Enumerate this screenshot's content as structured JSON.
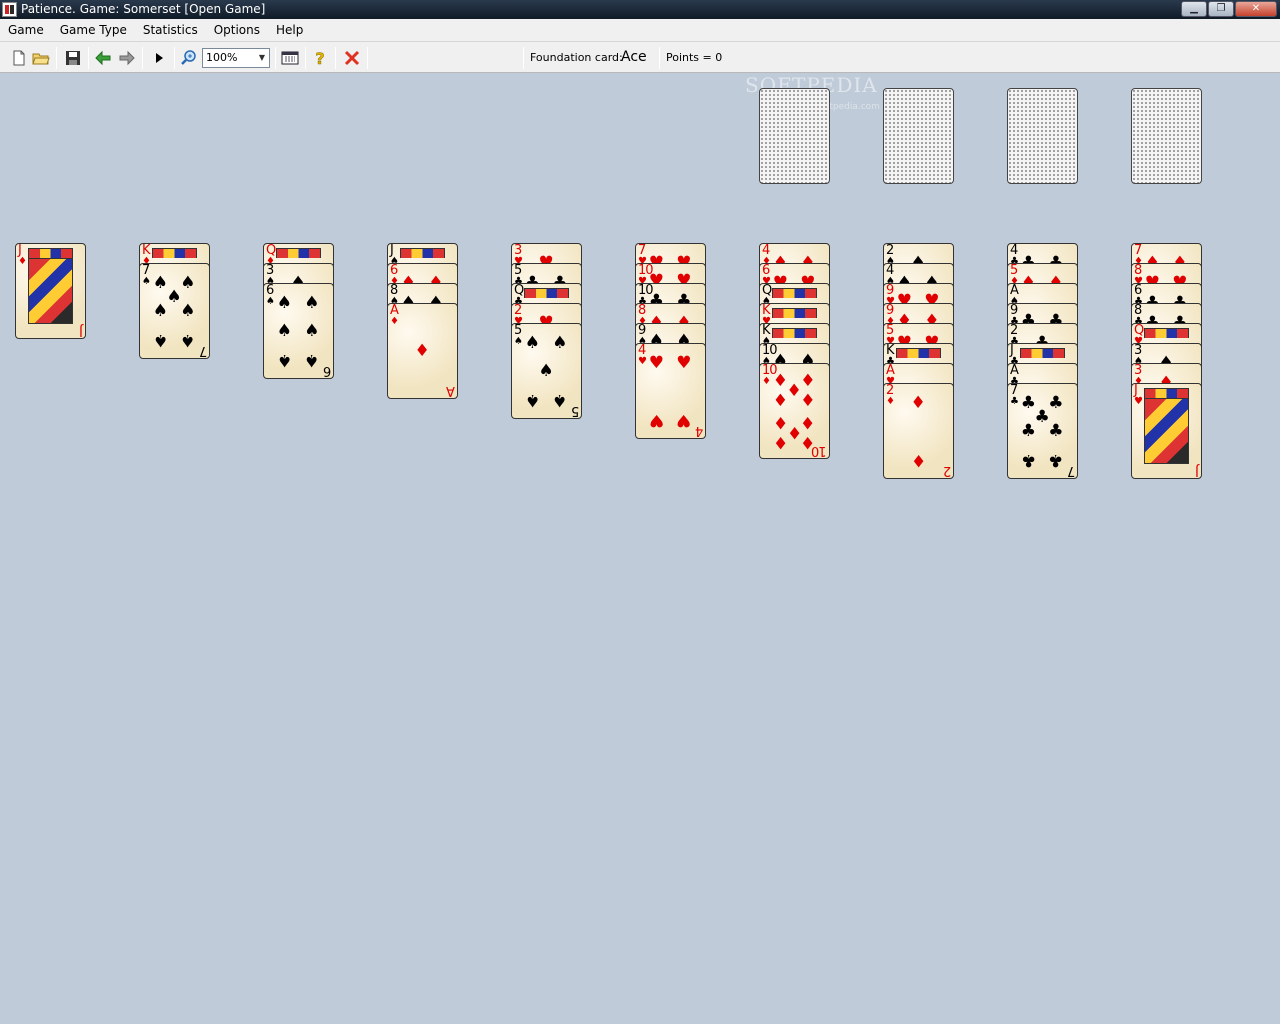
{
  "window": {
    "title": "Patience. Game: Somerset  [Open Game]",
    "controls": [
      "minimize",
      "maximize",
      "close"
    ]
  },
  "menu": [
    "Game",
    "Game Type",
    "Statistics",
    "Options",
    "Help"
  ],
  "toolbar": {
    "zoom_value": "100%",
    "foundation_label": "Foundation card:",
    "foundation_value": "Ace",
    "points_label": "Points = 0"
  },
  "watermark": {
    "text": "SOFTPEDIA",
    "sub": "www.softpedia.com"
  },
  "colors": {
    "table": "#bfcbd8",
    "red_suit": "#e00000",
    "black_suit": "#000000"
  },
  "foundations": [
    {
      "state": "empty"
    },
    {
      "state": "empty"
    },
    {
      "state": "empty"
    },
    {
      "state": "empty"
    }
  ],
  "tableau": [
    [
      {
        "rank": "J",
        "suit": "♦"
      }
    ],
    [
      {
        "rank": "K",
        "suit": "♦"
      },
      {
        "rank": "7",
        "suit": "♠"
      }
    ],
    [
      {
        "rank": "Q",
        "suit": "♦"
      },
      {
        "rank": "3",
        "suit": "♠"
      },
      {
        "rank": "6",
        "suit": "♠"
      }
    ],
    [
      {
        "rank": "J",
        "suit": "♠"
      },
      {
        "rank": "6",
        "suit": "♦"
      },
      {
        "rank": "8",
        "suit": "♠"
      },
      {
        "rank": "A",
        "suit": "♦"
      }
    ],
    [
      {
        "rank": "3",
        "suit": "♥"
      },
      {
        "rank": "5",
        "suit": "♣"
      },
      {
        "rank": "Q",
        "suit": "♣"
      },
      {
        "rank": "2",
        "suit": "♥"
      },
      {
        "rank": "5",
        "suit": "♠"
      }
    ],
    [
      {
        "rank": "7",
        "suit": "♥"
      },
      {
        "rank": "10",
        "suit": "♥"
      },
      {
        "rank": "10",
        "suit": "♣"
      },
      {
        "rank": "8",
        "suit": "♦"
      },
      {
        "rank": "9",
        "suit": "♠"
      },
      {
        "rank": "4",
        "suit": "♥"
      }
    ],
    [
      {
        "rank": "4",
        "suit": "♦"
      },
      {
        "rank": "6",
        "suit": "♥"
      },
      {
        "rank": "Q",
        "suit": "♠"
      },
      {
        "rank": "K",
        "suit": "♥"
      },
      {
        "rank": "K",
        "suit": "♠"
      },
      {
        "rank": "10",
        "suit": "♠"
      },
      {
        "rank": "10",
        "suit": "♦"
      }
    ],
    [
      {
        "rank": "2",
        "suit": "♠"
      },
      {
        "rank": "4",
        "suit": "♠"
      },
      {
        "rank": "9",
        "suit": "♥"
      },
      {
        "rank": "9",
        "suit": "♦"
      },
      {
        "rank": "5",
        "suit": "♥"
      },
      {
        "rank": "K",
        "suit": "♣"
      },
      {
        "rank": "A",
        "suit": "♥"
      },
      {
        "rank": "2",
        "suit": "♦"
      }
    ],
    [
      {
        "rank": "4",
        "suit": "♣"
      },
      {
        "rank": "5",
        "suit": "♦"
      },
      {
        "rank": "A",
        "suit": "♠"
      },
      {
        "rank": "9",
        "suit": "♣"
      },
      {
        "rank": "2",
        "suit": "♣"
      },
      {
        "rank": "J",
        "suit": "♣"
      },
      {
        "rank": "A",
        "suit": "♣"
      },
      {
        "rank": "7",
        "suit": "♣"
      }
    ],
    [
      {
        "rank": "7",
        "suit": "♦"
      },
      {
        "rank": "8",
        "suit": "♥"
      },
      {
        "rank": "6",
        "suit": "♣"
      },
      {
        "rank": "8",
        "suit": "♣"
      },
      {
        "rank": "Q",
        "suit": "♥"
      },
      {
        "rank": "3",
        "suit": "♠"
      },
      {
        "rank": "3",
        "suit": "♦"
      },
      {
        "rank": "J",
        "suit": "♥"
      }
    ]
  ]
}
